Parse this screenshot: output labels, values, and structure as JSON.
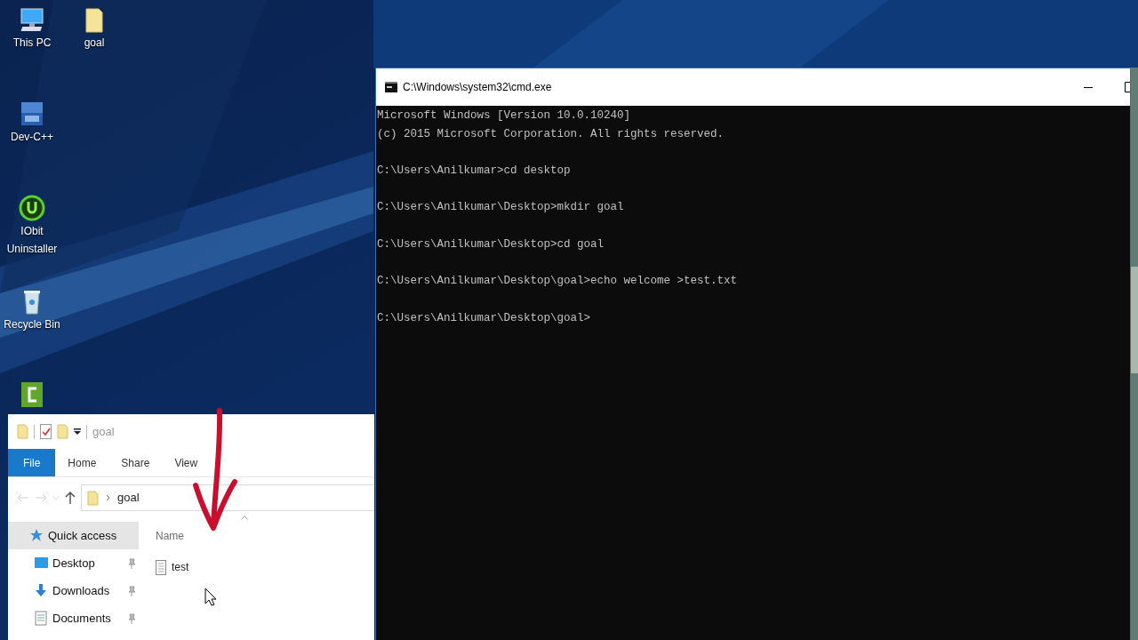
{
  "desktop_icons": [
    {
      "kind": "computer",
      "label": "This PC"
    },
    {
      "kind": "folder",
      "label": "goal"
    },
    {
      "kind": "devcpp",
      "label": "Dev-C++"
    },
    {
      "kind": "iobit",
      "label": "IObit Uninstaller"
    },
    {
      "kind": "recycle",
      "label": "Recycle Bin"
    },
    {
      "kind": "camtasia"
    }
  ],
  "cmd_window": {
    "title": "C:\\Windows\\system32\\cmd.exe",
    "blocks": [
      [
        "Microsoft Windows [Version 10.0.10240]",
        "(c) 2015 Microsoft Corporation. All rights reserved."
      ],
      [
        "C:\\Users\\Anilkumar>cd desktop"
      ],
      [
        "C:\\Users\\Anilkumar\\Desktop>mkdir goal"
      ],
      [
        "C:\\Users\\Anilkumar\\Desktop>cd goal"
      ],
      [
        "C:\\Users\\Anilkumar\\Desktop\\goal>echo welcome >test.txt"
      ],
      [
        "C:\\Users\\Anilkumar\\Desktop\\goal>"
      ]
    ]
  },
  "explorer": {
    "title": "goal",
    "ribbon_tabs": [
      {
        "label": "File",
        "kind": "menu"
      },
      {
        "label": "Home",
        "kind": "tab"
      },
      {
        "label": "Share",
        "kind": "tab"
      },
      {
        "label": "View",
        "kind": "tab"
      }
    ],
    "breadcrumb": "goal",
    "nav_items": [
      {
        "label": "Quick access",
        "kind": "star",
        "selected": true,
        "pinned": false
      },
      {
        "label": "Desktop",
        "kind": "desktop",
        "selected": false,
        "pinned": true
      },
      {
        "label": "Downloads",
        "kind": "download",
        "selected": false,
        "pinned": true
      },
      {
        "label": "Documents",
        "kind": "document",
        "selected": false,
        "pinned": true
      }
    ],
    "column_header": "Name",
    "files": [
      {
        "name": "test"
      }
    ]
  }
}
